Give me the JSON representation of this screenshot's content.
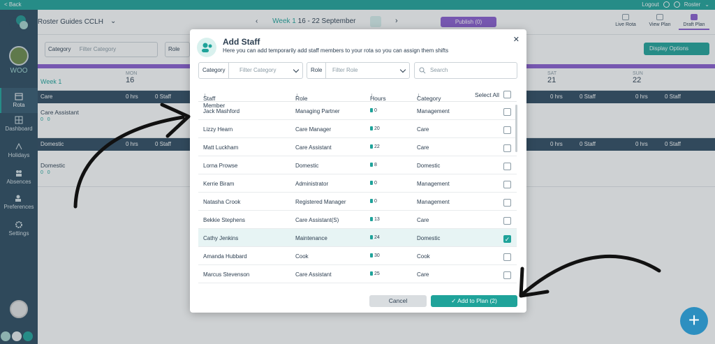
{
  "topbar": {
    "back": "< Back",
    "logout": "Logout",
    "user": "Roster"
  },
  "header": {
    "org": "Roster Guides CCLH",
    "week": "Week 1",
    "range": "16 - 22 September",
    "publish": "Publish (0)",
    "tabs": [
      {
        "label": "Live Rota"
      },
      {
        "label": "View Plan"
      },
      {
        "label": "Draft Plan"
      }
    ]
  },
  "sidebar": {
    "org_short": "WOO",
    "items": [
      {
        "label": "Rota"
      },
      {
        "label": "Dashboard"
      },
      {
        "label": "Holidays"
      },
      {
        "label": "Absences"
      },
      {
        "label": "Preferences"
      },
      {
        "label": "Settings"
      }
    ]
  },
  "filters": {
    "category": "Category",
    "category_ph": "Filter Category",
    "role": "Role",
    "display": "Display Options"
  },
  "grid": {
    "week": "Week 1",
    "days": [
      {
        "d": "MON",
        "n": "16"
      },
      {
        "d": "SAT",
        "n": "21"
      },
      {
        "d": "SUN",
        "n": "22"
      }
    ],
    "rows": [
      {
        "label": "Care",
        "hrs": "0 hrs",
        "staff": "0 Staff"
      },
      {
        "label": "Care Assistant",
        "c1": "0",
        "c2": "0"
      },
      {
        "label": "Domestic",
        "hrs": "0 hrs",
        "staff": "0 Staff"
      },
      {
        "label": "Domestic",
        "c1": "0",
        "c2": "0"
      }
    ]
  },
  "modal": {
    "title": "Add Staff",
    "subtitle": "Here you can add temporarily add staff members to your rota so you can assign them shifts",
    "filter_category_label": "Category",
    "filter_category_ph": "Filter Category",
    "filter_role_label": "Role",
    "filter_role_ph": "Filter Role",
    "search_ph": "Search",
    "columns": {
      "name": "Staff Member",
      "role": "Role",
      "hours": "Hours",
      "category": "Category",
      "select_all": "Select All"
    },
    "rows": [
      {
        "name": "Jack Mashford",
        "role": "Managing Partner",
        "hours": "0",
        "category": "Management",
        "checked": false
      },
      {
        "name": "Lizzy Hearn",
        "role": "Care Manager",
        "hours": "20",
        "category": "Care",
        "checked": false
      },
      {
        "name": "Matt Luckham",
        "role": "Care Assistant",
        "hours": "22",
        "category": "Care",
        "checked": false
      },
      {
        "name": "Lorna Prowse",
        "role": "Domestic",
        "hours": "8",
        "category": "Domestic",
        "checked": false
      },
      {
        "name": "Kerrie Biram",
        "role": "Administrator",
        "hours": "0",
        "category": "Management",
        "checked": false
      },
      {
        "name": "Natasha Crook",
        "role": "Registered Manager",
        "hours": "0",
        "category": "Management",
        "checked": false
      },
      {
        "name": "Bekkie Stephens",
        "role": "Care Assistant(S)",
        "hours": "13",
        "category": "Care",
        "checked": false
      },
      {
        "name": "Cathy Jenkins",
        "role": "Maintenance",
        "hours": "24",
        "category": "Domestic",
        "checked": true
      },
      {
        "name": "Amanda Hubbard",
        "role": "Cook",
        "hours": "30",
        "category": "Cook",
        "checked": false
      },
      {
        "name": "Marcus Stevenson",
        "role": "Care Assistant",
        "hours": "25",
        "category": "Care",
        "checked": false
      }
    ],
    "cancel": "Cancel",
    "add": "Add to Plan (2)"
  }
}
